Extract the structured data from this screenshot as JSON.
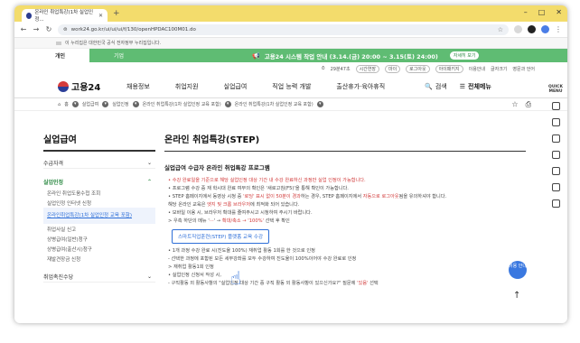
{
  "browser": {
    "tab_title": "온라인 취업특강(1차 실업인정...",
    "url": "work24.go.kr/ui/ui/ui/f/130/openHPDAC100M01.do",
    "new_tab": "+"
  },
  "notice": {
    "text": "이 누리집은 대한민국 공식 전자정부 누리집입니다."
  },
  "greenbar": {
    "tab_personal": "개인",
    "tab_company": "기업",
    "announcement": "고용24 시스템 작업 안내 (3.14.(금) 20:00 ~ 3.15(토) 24:00)",
    "detail_button": "자세히 보기"
  },
  "utilbar": {
    "items": [
      "29분47초",
      "시간연장",
      "마이",
      "로그아웃",
      "아이패키지",
      "이용안내",
      "글자크기",
      "영문과 언어"
    ]
  },
  "mainnav": {
    "logo": "고용24",
    "menus": [
      "채용정보",
      "취업지원",
      "실업급여",
      "직업 능력 개발",
      "출산휴가·육아휴직"
    ],
    "search": "검색",
    "all_menu": "전체메뉴"
  },
  "breadcrumbs": [
    "홈",
    "실업급여",
    "실업인정",
    "온라인 취업특강(1차 실업인정 교육 포함)",
    "온라인 취업특강(1차 실업인정 교육 포함)"
  ],
  "sidebar": {
    "title": "실업급여",
    "section1": "수급자격",
    "section2": "실업인정",
    "subitems": [
      "온라인 취업도움수첩 조회",
      "실업인정 인터넷 신청",
      "온라인취업특강(1차 실업인정 교육 포함)",
      "취업사실 신고",
      "상병급여(일반)청구",
      "상병급여(출산시)청구",
      "재발견장금 신청"
    ],
    "section3": "취업촉진수당"
  },
  "content": {
    "title": "온라인 취업특강(STEP)",
    "subtitle": "실업급여 수급자 온라인 취업특강 프로그램",
    "line1": "• 수강 완료일을 기준으로 해당 실업인정 대상 기간 내 수강 완료하신 과정만 실업 인정이 가능합니다.",
    "line2": "• 프로그램 수강 중 재 학시대 완료 여부의 확인은 '새로고침(F5)'을 통해 확인이 가능합니다.",
    "line3a": "• STEP 홈페이지에서 동영상 시청 중 ",
    "line3b": "'로딩' 표시 없이 50분이 경과",
    "line3c": "하는 경우, STEP 홈페이지에서 ",
    "line3d": "자동으로 로그아웃",
    "line3e": "됨을 유의하셔야 합니다.",
    "line4a": "  해당 온라인 교육은 ",
    "line4b": "엣지 및 크롬 브라우저",
    "line4c": "에 최적화 되어 있습니다.",
    "line5": "• 모바일 이용 시, 브라우저 확대를 줄여주시고 시청하여 주시기 바랍니다.",
    "line6a": "  > 우측 하단의 메뉴 '",
    "line6b": "···",
    "line6c": "' → ",
    "line6d": "확대/축소 → '100%'",
    "line6e": " 선택 후 확인",
    "cta": "스마트직업훈련(STEP) 플랫폼 교육 수강",
    "line7": "• 1개 과정 수강 완료 시(진도율 100%) 재취업 활동 1회를 한 것으로 인정",
    "line8": "  - 선택한 과정에 포함된 모든 세부강좌를 모두 수강하여 진도율이 100%이어야 수강 완료로 인정",
    "line9": "  > 재취업 활동1회 인정",
    "line10": "• 실업인정 신청서 작성 시,",
    "line11a": "  - 구직활동 외 활동사항의 \"실업인정 대상 기간 중 구직 활동 외 활동사항이 있으신가요?\" 질문에 ",
    "line11b": "'있음'",
    "line11c": " 선택"
  },
  "rightbar": {
    "label": "QUICK MENU"
  },
  "chatbot": {
    "label": "이용 안내"
  },
  "totop": "↑"
}
